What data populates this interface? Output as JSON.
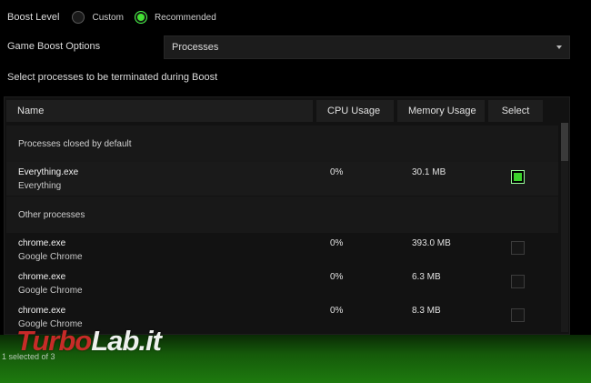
{
  "boost_level": {
    "label": "Boost Level",
    "options": [
      {
        "label": "Custom",
        "selected": false
      },
      {
        "label": "Recommended",
        "selected": true
      }
    ]
  },
  "game_boost": {
    "label": "Game Boost Options",
    "selected": "Processes"
  },
  "instruction": "Select processes to be terminated during Boost",
  "table": {
    "headers": {
      "name": "Name",
      "cpu": "CPU Usage",
      "memory": "Memory Usage",
      "select": "Select"
    },
    "sections": [
      {
        "title": "Processes closed by default",
        "rows": [
          {
            "name": "Everything.exe",
            "desc": "Everything",
            "cpu": "0%",
            "mem": "30.1 MB",
            "checked": true
          }
        ]
      },
      {
        "title": "Other processes",
        "rows": [
          {
            "name": "chrome.exe",
            "desc": "Google Chrome",
            "cpu": "0%",
            "mem": "393.0 MB",
            "checked": false
          },
          {
            "name": "chrome.exe",
            "desc": "Google Chrome",
            "cpu": "0%",
            "mem": "6.3 MB",
            "checked": false
          },
          {
            "name": "chrome.exe",
            "desc": "Google Chrome",
            "cpu": "0%",
            "mem": "8.3 MB",
            "checked": false
          }
        ]
      }
    ]
  },
  "footer": {
    "status": "1 selected of 3"
  },
  "watermark": {
    "part1": "Turbo",
    "part2": "Lab.it"
  },
  "colors": {
    "accent_green": "#44e234",
    "background": "#000000",
    "panel": "#121212"
  }
}
